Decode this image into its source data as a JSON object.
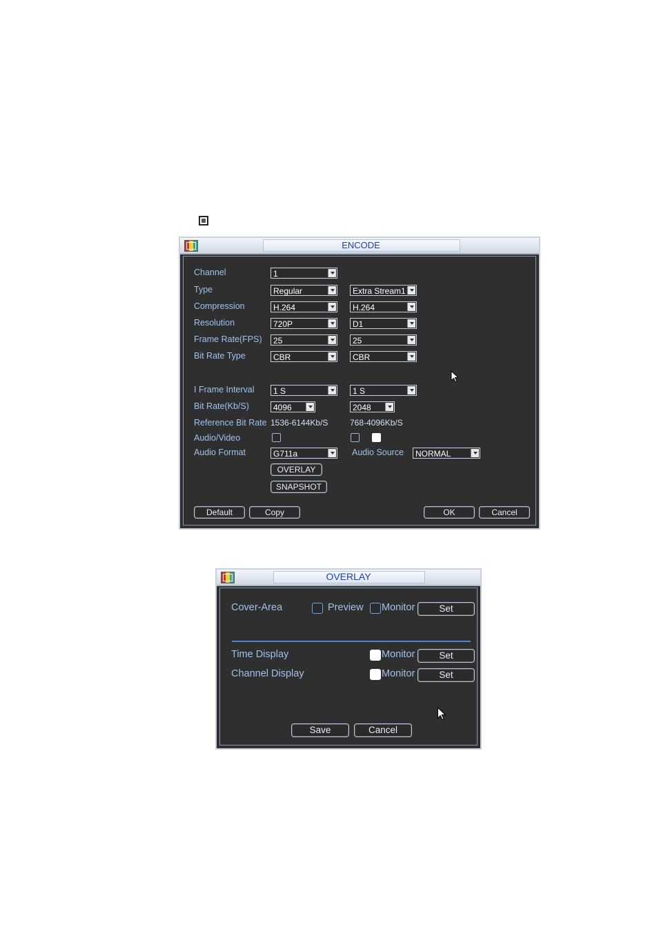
{
  "encode": {
    "title": "ENCODE",
    "labels": {
      "channel": "Channel",
      "type": "Type",
      "compression": "Compression",
      "resolution": "Resolution",
      "frame_rate": "Frame Rate(FPS)",
      "bit_rate_type": "Bit Rate Type",
      "i_frame_interval": "I Frame Interval",
      "bit_rate": "Bit Rate(Kb/S)",
      "reference_bit_rate": "Reference Bit Rate",
      "audio_video": "Audio/Video",
      "audio_format": "Audio Format",
      "audio_source": "Audio Source"
    },
    "main": {
      "channel": "1",
      "type": "Regular",
      "compression": "H.264",
      "resolution": "720P",
      "frame_rate": "25",
      "bit_rate_type": "CBR",
      "i_frame_interval": "1 S",
      "bit_rate": "4096",
      "reference_bit_rate": "1536-6144Kb/S",
      "audio_format": "G711a"
    },
    "extra": {
      "type": "Extra Stream1",
      "compression": "H.264",
      "resolution": "D1",
      "frame_rate": "25",
      "bit_rate_type": "CBR",
      "i_frame_interval": "1 S",
      "bit_rate": "2048",
      "reference_bit_rate": "768-4096Kb/S"
    },
    "audio_source": "NORMAL",
    "buttons": {
      "overlay": "OVERLAY",
      "snapshot": "SNAPSHOT",
      "default": "Default",
      "copy": "Copy",
      "ok": "OK",
      "cancel": "Cancel"
    }
  },
  "overlay": {
    "title": "OVERLAY",
    "cover_area": "Cover-Area",
    "preview": "Preview",
    "monitor": "Monitor",
    "set": "Set",
    "time_display": "Time Display",
    "channel_display": "Channel Display",
    "save": "Save",
    "cancel": "Cancel"
  }
}
